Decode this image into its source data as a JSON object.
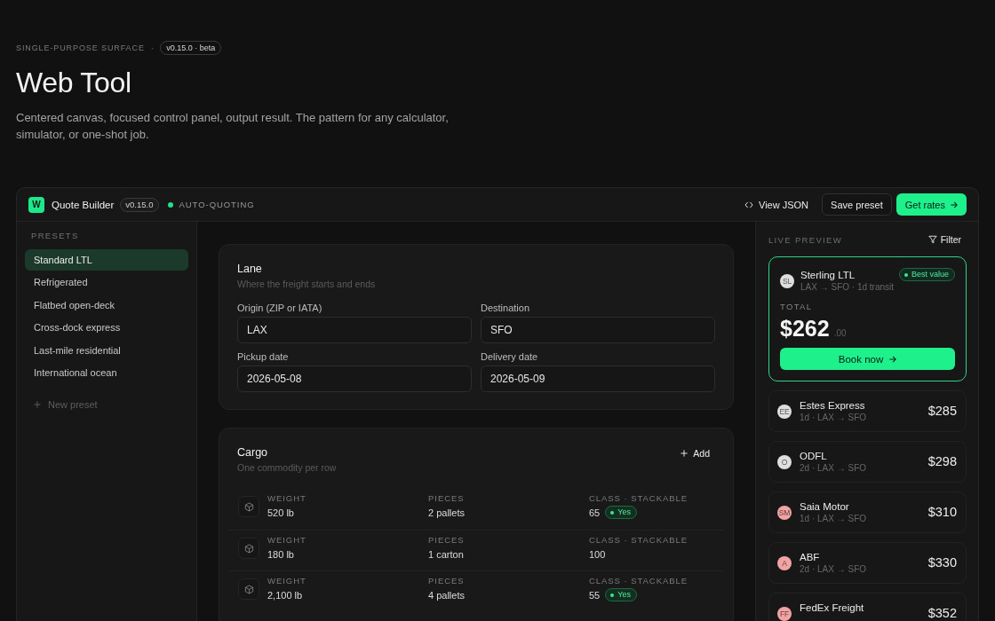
{
  "header": {
    "eyebrow": "SINGLE-PURPOSE SURFACE",
    "separator": "·",
    "version_badge": "v0.15.0 · beta",
    "title": "Web Tool",
    "description": "Centered canvas, focused control panel, output result. The pattern for any calculator, simulator, or one-shot job."
  },
  "topbar": {
    "logo": "W",
    "name": "Quote Builder",
    "version": "v0.15.0",
    "status": {
      "label": "AUTO-QUOTING",
      "active": true
    },
    "actions": [
      {
        "kind": "link",
        "label": "View JSON"
      },
      {
        "kind": "secondary",
        "label": "Save preset"
      },
      {
        "kind": "primary",
        "label": "Get rates"
      }
    ]
  },
  "sidebar": {
    "heading": "PRESETS",
    "items": [
      {
        "label": "Standard LTL",
        "selected": true
      },
      {
        "label": "Refrigerated",
        "selected": false
      },
      {
        "label": "Flatbed open-deck",
        "selected": false
      },
      {
        "label": "Cross-dock express",
        "selected": false
      },
      {
        "label": "Last-mile residential",
        "selected": false
      },
      {
        "label": "International ocean",
        "selected": false
      }
    ],
    "new_item": "New preset"
  },
  "lane": {
    "title": "Lane",
    "subtitle": "Where the freight starts and ends",
    "fields": [
      {
        "label": "Origin (ZIP or IATA)",
        "value": "LAX"
      },
      {
        "label": "Destination",
        "value": "SFO"
      },
      {
        "label": "Pickup date",
        "value": "2026-05-08"
      },
      {
        "label": "Delivery date",
        "value": "2026-05-09"
      }
    ]
  },
  "cargo": {
    "title": "Cargo",
    "subtitle": "One commodity per row",
    "add_label": "Add",
    "rows": [
      {
        "cells": [
          {
            "label": "WEIGHT",
            "value": "520 lb"
          },
          {
            "label": "PIECES",
            "value": "2 pallets"
          },
          {
            "label": "CLASS · STACKABLE",
            "value": "65"
          }
        ],
        "stackable": true,
        "tag": "Yes"
      },
      {
        "cells": [
          {
            "label": "WEIGHT",
            "value": "180 lb"
          },
          {
            "label": "PIECES",
            "value": "1 carton"
          },
          {
            "label": "CLASS · STACKABLE",
            "value": "100"
          }
        ],
        "stackable": false
      },
      {
        "cells": [
          {
            "label": "WEIGHT",
            "value": "2,100 lb"
          },
          {
            "label": "PIECES",
            "value": "4 pallets"
          },
          {
            "label": "CLASS · STACKABLE",
            "value": "55"
          }
        ],
        "stackable": true,
        "tag": "Yes"
      }
    ]
  },
  "preview": {
    "heading": "LIVE PREVIEW",
    "filter": "Filter",
    "best": {
      "initials": "SL",
      "color": "#dedede",
      "carrier": "Sterling LTL",
      "meta": "LAX → SFO · 1d transit",
      "badge": "Best value",
      "total_label": "TOTAL",
      "price": "$262",
      "cents": ".00",
      "action": "Book now"
    },
    "quotes": [
      {
        "initials": "EE",
        "color": "#dedede",
        "carrier": "Estes Express",
        "meta": "1d · LAX → SFO",
        "price": "$285"
      },
      {
        "initials": "O",
        "color": "#dedede",
        "carrier": "ODFL",
        "meta": "2d · LAX → SFO",
        "price": "$298"
      },
      {
        "initials": "SM",
        "color": "#f2a3a3",
        "carrier": "Saia Motor",
        "meta": "1d · LAX → SFO",
        "price": "$310"
      },
      {
        "initials": "A",
        "color": "#f2a3a3",
        "carrier": "ABF",
        "meta": "2d · LAX → SFO",
        "price": "$330"
      },
      {
        "initials": "FF",
        "color": "#f2a3a3",
        "carrier": "FedEx Freight",
        "price": "$352"
      }
    ]
  }
}
